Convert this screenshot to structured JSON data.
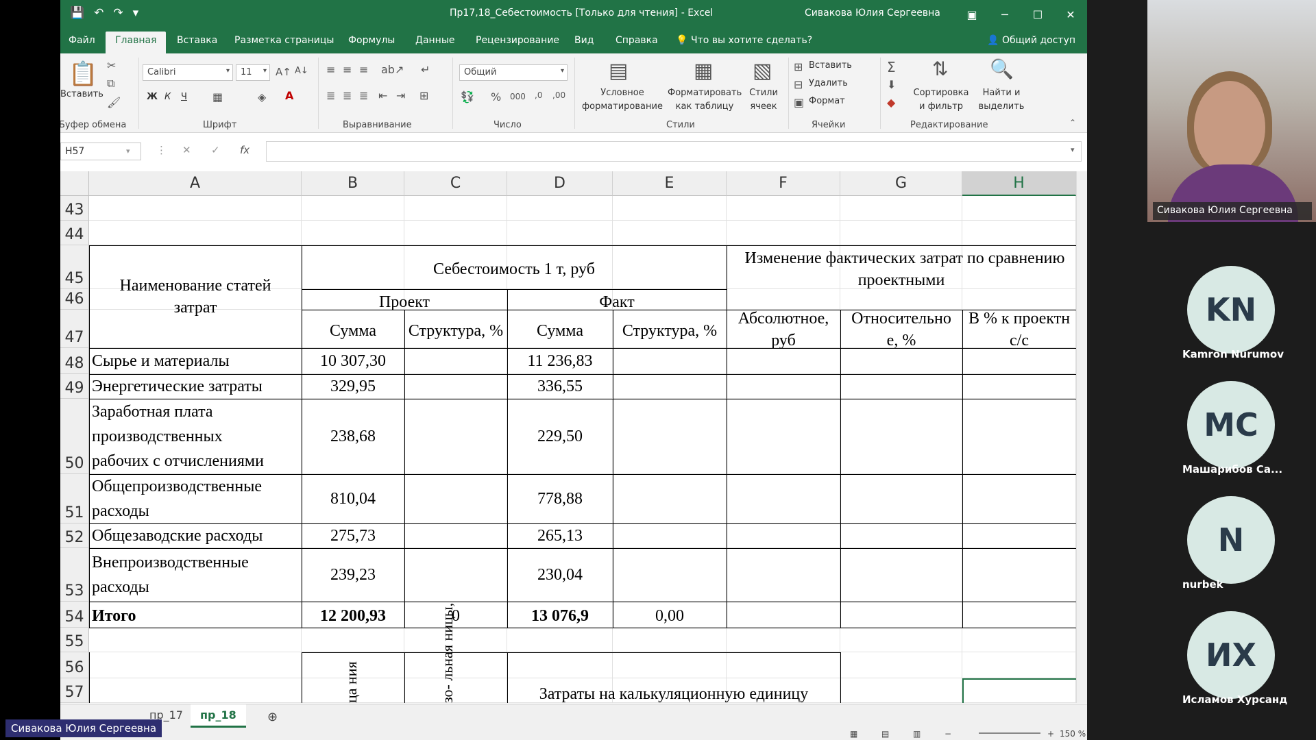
{
  "window": {
    "title": "Пр17,18_Себестоимость  [Только для чтения]  -  Excel",
    "user": "Сивакова Юлия Сергеевна"
  },
  "tabs": [
    "Файл",
    "Главная",
    "Вставка",
    "Разметка страницы",
    "Формулы",
    "Данные",
    "Рецензирование",
    "Вид",
    "Справка",
    "Что вы хотите сделать?",
    "Общий доступ"
  ],
  "ribbon": {
    "paste": "Вставить",
    "clipboard": "Буфер обмена",
    "font_name": "Calibri",
    "font_size": "11",
    "font_group": "Шрифт",
    "bold": "Ж",
    "italic": "К",
    "underline": "Ч",
    "align_group": "Выравнивание",
    "number_format": "Общий",
    "number_group": "Число",
    "cond_format_1": "Условное",
    "cond_format_2": "форматирование",
    "format_table_1": "Форматировать",
    "format_table_2": "как таблицу",
    "cell_styles_1": "Стили",
    "cell_styles_2": "ячеек",
    "styles_group": "Стили",
    "insert": "Вставить",
    "delete": "Удалить",
    "format": "Формат",
    "cells_group": "Ячейки",
    "sort_1": "Сортировка",
    "sort_2": "и фильтр",
    "find_1": "Найти и",
    "find_2": "выделить",
    "edit_group": "Редактирование"
  },
  "namebox": "H57",
  "columns": [
    "A",
    "B",
    "C",
    "D",
    "E",
    "F",
    "G",
    "H"
  ],
  "rows": [
    "43",
    "44",
    "45",
    "46",
    "47",
    "48",
    "49",
    "50",
    "51",
    "52",
    "53",
    "54",
    "55",
    "56",
    "57"
  ],
  "table": {
    "h_cost_items_1": "Наименование статей",
    "h_cost_items_2": "затрат",
    "h_cost_per_ton": "Себестоимость 1 т, руб",
    "h_change_1": "Изменение фактических затрат по сравнению",
    "h_change_2": "проектными",
    "h_project": "Проект",
    "h_fact": "Факт",
    "h_sum": "Сумма",
    "h_structure": "Структура, %",
    "h_abs_1": "Абсолютное,",
    "h_abs_2": "руб",
    "h_rel_1": "Относительно",
    "h_rel_2": "е, %",
    "h_pct_1": "В % к проектн",
    "h_pct_2": "с/с",
    "rows": [
      {
        "name": [
          "Сырье и материалы"
        ],
        "proj": "10 307,30",
        "fact": "11 236,83"
      },
      {
        "name": [
          "Энергетические затраты"
        ],
        "proj": "329,95",
        "fact": "336,55"
      },
      {
        "name": [
          "Заработная          плата",
          "производственных",
          "рабочих с отчислениями"
        ],
        "proj": "238,68",
        "fact": "229,50"
      },
      {
        "name": [
          "Общепроизводственные",
          "расходы"
        ],
        "proj": "810,04",
        "fact": "778,88"
      },
      {
        "name": [
          "Общезаводские расходы"
        ],
        "proj": "275,73",
        "fact": "265,13"
      },
      {
        "name": [
          "Внепроизводственные",
          "расходы"
        ],
        "proj": "239,23",
        "fact": "230,04"
      }
    ],
    "total_label": "Итого",
    "total_proj": "12 200,93",
    "total_proj_struct": "0",
    "total_fact": "13 076,9",
    "total_fact_struct": "0,00",
    "rot_b": "ца ния",
    "rot_c": "зо- льная ницы,",
    "calc_unit": "Затраты на калькуляционную единицу"
  },
  "sheet_tabs": [
    "пр_17",
    "пр_18"
  ],
  "zoom": "150 %",
  "participants": [
    {
      "initials": "KN",
      "name": "Kamron Nurumov"
    },
    {
      "initials": "MC",
      "name": "Машарибов Са..."
    },
    {
      "initials": "N",
      "name": "nurbek"
    },
    {
      "initials": "ИХ",
      "name": "Исламов Хурсанд"
    }
  ],
  "presenter": "Сивакова Юлия Сергеевна",
  "colors": {
    "excel_green": "#217346",
    "avatar_bg": "#d8e9e4",
    "presenter_bg": "#2e2e70"
  }
}
